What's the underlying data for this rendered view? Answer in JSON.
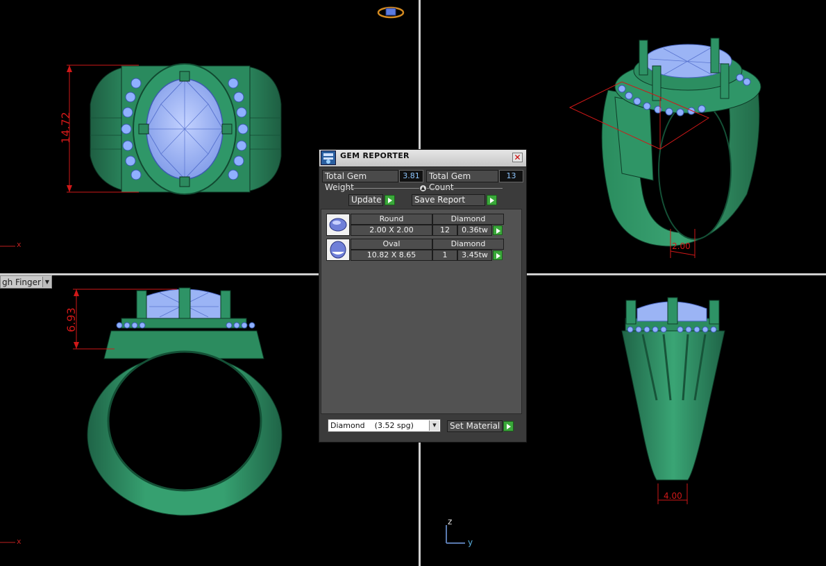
{
  "viewports": {
    "top": {
      "dimension": "14.72",
      "axis_x": "x"
    },
    "perspective": {
      "dimension": "2.00"
    },
    "front": {
      "dimension": "6.93",
      "axis_x": "x",
      "view_mode": "gh Finger"
    },
    "right": {
      "dimension": "4.00",
      "axis_z": "z",
      "axis_y": "y"
    }
  },
  "gem_reporter": {
    "title": "GEM REPORTER",
    "total_weight_label": "Total Gem Weight",
    "total_weight_value": "3.81",
    "total_count_label": "Total Gem Count",
    "total_count_value": "13",
    "update_label": "Update",
    "save_report_label": "Save Report",
    "gems": [
      {
        "shape": "Round",
        "material": "Diamond",
        "size": "2.00 X 2.00",
        "count": "12",
        "weight": "0.36tw"
      },
      {
        "shape": "Oval",
        "material": "Diamond",
        "size": "10.82 X 8.65",
        "count": "1",
        "weight": "3.45tw"
      }
    ],
    "material_select": "Diamond    (3.52 spg)",
    "set_material_label": "Set Material"
  },
  "colors": {
    "metal": "#2e8f63",
    "gem": "#9bb4f5",
    "dimension": "#d01818",
    "background": "#000000"
  }
}
